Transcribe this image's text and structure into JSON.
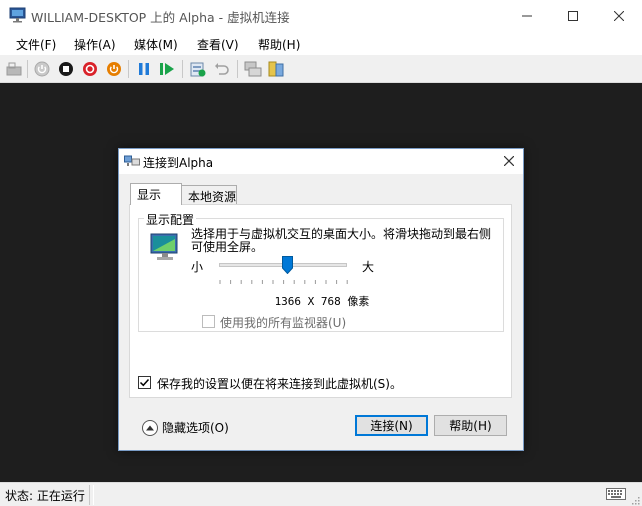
{
  "window": {
    "title": "WILLIAM-DESKTOP 上的 Alpha - 虚拟机连接"
  },
  "menu": [
    "文件(F)",
    "操作(A)",
    "媒体(M)",
    "查看(V)",
    "帮助(H)"
  ],
  "dialog": {
    "title": "连接到Alpha",
    "tabs": [
      "显示",
      "本地资源"
    ],
    "group_label": "显示配置",
    "description": "选择用于与虚拟机交互的桌面大小。将滑块拖动到最右侧可使用全屏。",
    "slider": {
      "min_label": "小",
      "max_label": "大",
      "level": 0.5
    },
    "resolution": "1366 X 768 像素",
    "all_monitors": {
      "label": "使用我的所有监视器(U)",
      "checked": false
    },
    "save_settings": {
      "label": "保存我的设置以便在将来连接到此虚拟机(S)。",
      "checked": true
    },
    "hide_options_label": "隐藏选项(O)",
    "connect_label": "连接(N)",
    "help_label": "帮助(H)"
  },
  "status": {
    "text": "状态: 正在运行"
  },
  "colors": {
    "console_bg": "#1e1e1e",
    "accent": "#0078d7",
    "power_red": "#d9222a",
    "power_orange": "#e67e00",
    "play_green": "#1aa34a"
  }
}
